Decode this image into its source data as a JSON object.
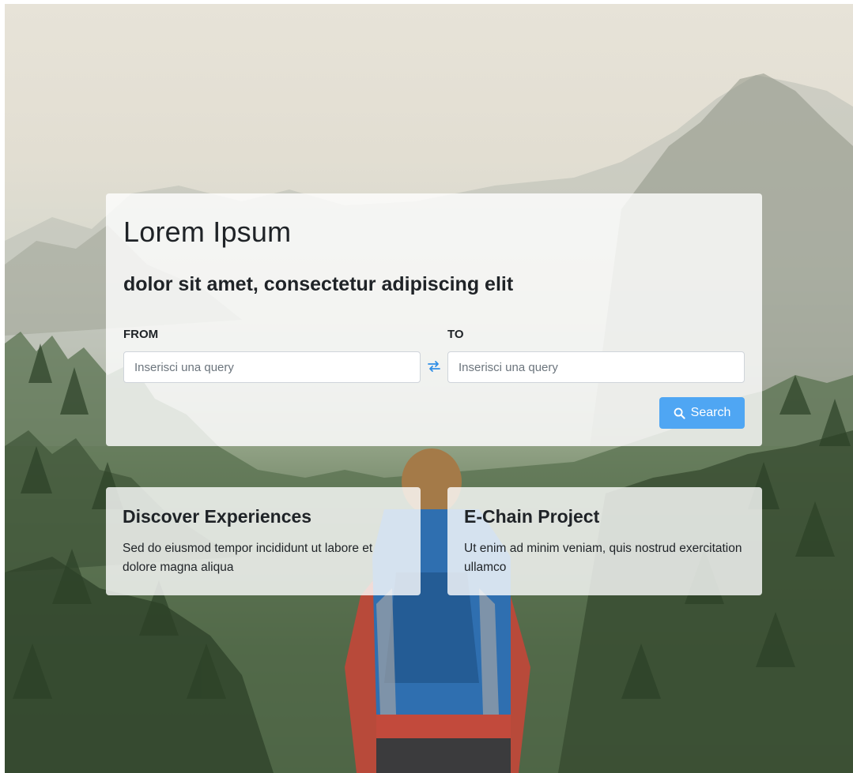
{
  "hero": {
    "title": "Lorem Ipsum",
    "subtitle": "dolor sit amet, consectetur adipiscing elit"
  },
  "search": {
    "from_label": "FROM",
    "to_label": "TO",
    "from_placeholder": "Inserisci una query",
    "to_placeholder": "Inserisci una query",
    "swap_icon": "swap-arrows-icon",
    "button_icon": "search-icon",
    "button_label": "Search"
  },
  "cards": [
    {
      "title": "Discover Experiences",
      "text": "Sed do eiusmod tempor incididunt ut labore et dolore magna aliqua"
    },
    {
      "title": "E-Chain Project",
      "text": "Ut enim ad minim veniam, quis nostrud exercitation ullamco"
    }
  ],
  "colors": {
    "accent": "#4fa6f3",
    "swap_icon": "#2f8fe6",
    "text": "#1f2327"
  }
}
